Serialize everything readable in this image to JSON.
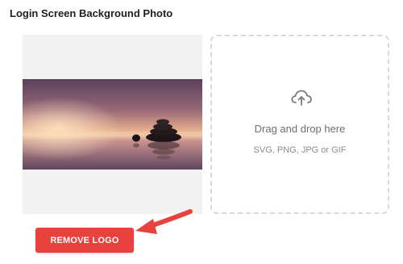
{
  "section": {
    "title": "Login Screen Background Photo"
  },
  "preview": {
    "image_subject": "zen stones on water at sunset"
  },
  "dropzone": {
    "icon": "cloud-upload-icon",
    "title": "Drag and drop here",
    "formats": "SVG, PNG, JPG or GIF"
  },
  "actions": {
    "remove_label": "REMOVE LOGO"
  },
  "annotation": {
    "icon": "arrow-icon",
    "color": "#e9413d"
  },
  "colors": {
    "accent": "#e9413d",
    "dropzone_border": "#d9d9d9",
    "preview_background": "#f2f2f2"
  }
}
